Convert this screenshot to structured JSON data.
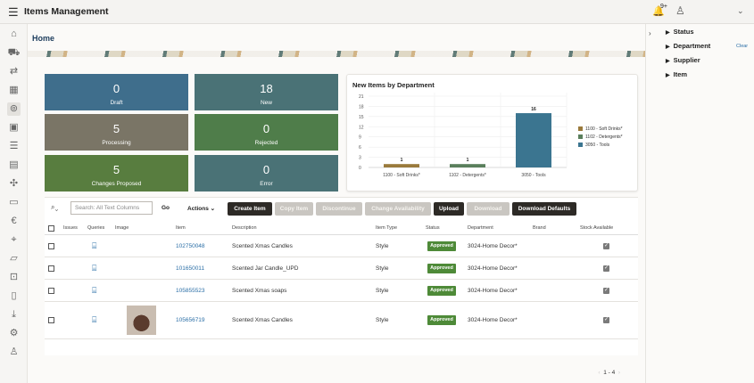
{
  "topbar": {
    "menu_icon": "hamburger-icon",
    "title": "Items Management",
    "notif_count": "9+"
  },
  "breadcrumb": "Home",
  "tiles": [
    {
      "value": "0",
      "label": "Draft",
      "color": "#3f6e8c"
    },
    {
      "value": "18",
      "label": "New",
      "color": "#4a7276"
    },
    {
      "value": "5",
      "label": "Processing",
      "color": "#7a7566"
    },
    {
      "value": "0",
      "label": "Rejected",
      "color": "#4f7d4a"
    },
    {
      "value": "5",
      "label": "Changes Proposed",
      "color": "#587d3f"
    },
    {
      "value": "0",
      "label": "Error",
      "color": "#4a7276"
    }
  ],
  "chart_data": {
    "type": "bar",
    "title": "New Items by Department",
    "categories": [
      "1100 - Soft Drinks*",
      "1102 - Detergents*",
      "3050 - Tools"
    ],
    "values": [
      1,
      1,
      16
    ],
    "colors": [
      "#9a7a3c",
      "#5a7f5c",
      "#3b7590"
    ],
    "yticks": [
      0,
      3,
      6,
      9,
      12,
      15,
      18,
      21
    ],
    "ylim": [
      0,
      21
    ],
    "legend": [
      "1100 - Soft Drinks*",
      "1102 - Detergents*",
      "3050 - Tools"
    ],
    "legend_position": "right"
  },
  "toolbar": {
    "search_placeholder": "Search: All Text Columns",
    "go": "Go",
    "actions": "Actions",
    "create_item": "Create Item",
    "copy_item": "Copy Item",
    "discontinue": "Discontinue",
    "change_availability": "Change Availability",
    "upload": "Upload",
    "download": "Download",
    "download_defaults": "Download Defaults"
  },
  "columns": [
    "Issues",
    "Queries",
    "Image",
    "Item",
    "Description",
    "Item Type",
    "Status",
    "Department",
    "Brand",
    "Stock Available"
  ],
  "rows": [
    {
      "item": "102750048",
      "description": "Scented Xmas Candles",
      "item_type": "Style",
      "status": "Approved",
      "department": "3024-Home Decor*",
      "has_image": false
    },
    {
      "item": "101650011",
      "description": "Scented Jar Candle_UPD",
      "item_type": "Style",
      "status": "Approved",
      "department": "3024-Home Decor*",
      "has_image": false
    },
    {
      "item": "105855523",
      "description": "Scented Xmas soaps",
      "item_type": "Style",
      "status": "Approved",
      "department": "3024-Home Decor*",
      "has_image": false
    },
    {
      "item": "105656719",
      "description": "Scented Xmas Candles",
      "item_type": "Style",
      "status": "Approved",
      "department": "3024-Home Decor*",
      "has_image": true
    }
  ],
  "pager": "1 - 4",
  "filters": [
    "Status",
    "Department",
    "Supplier",
    "Item"
  ],
  "clear_label": "Clear"
}
